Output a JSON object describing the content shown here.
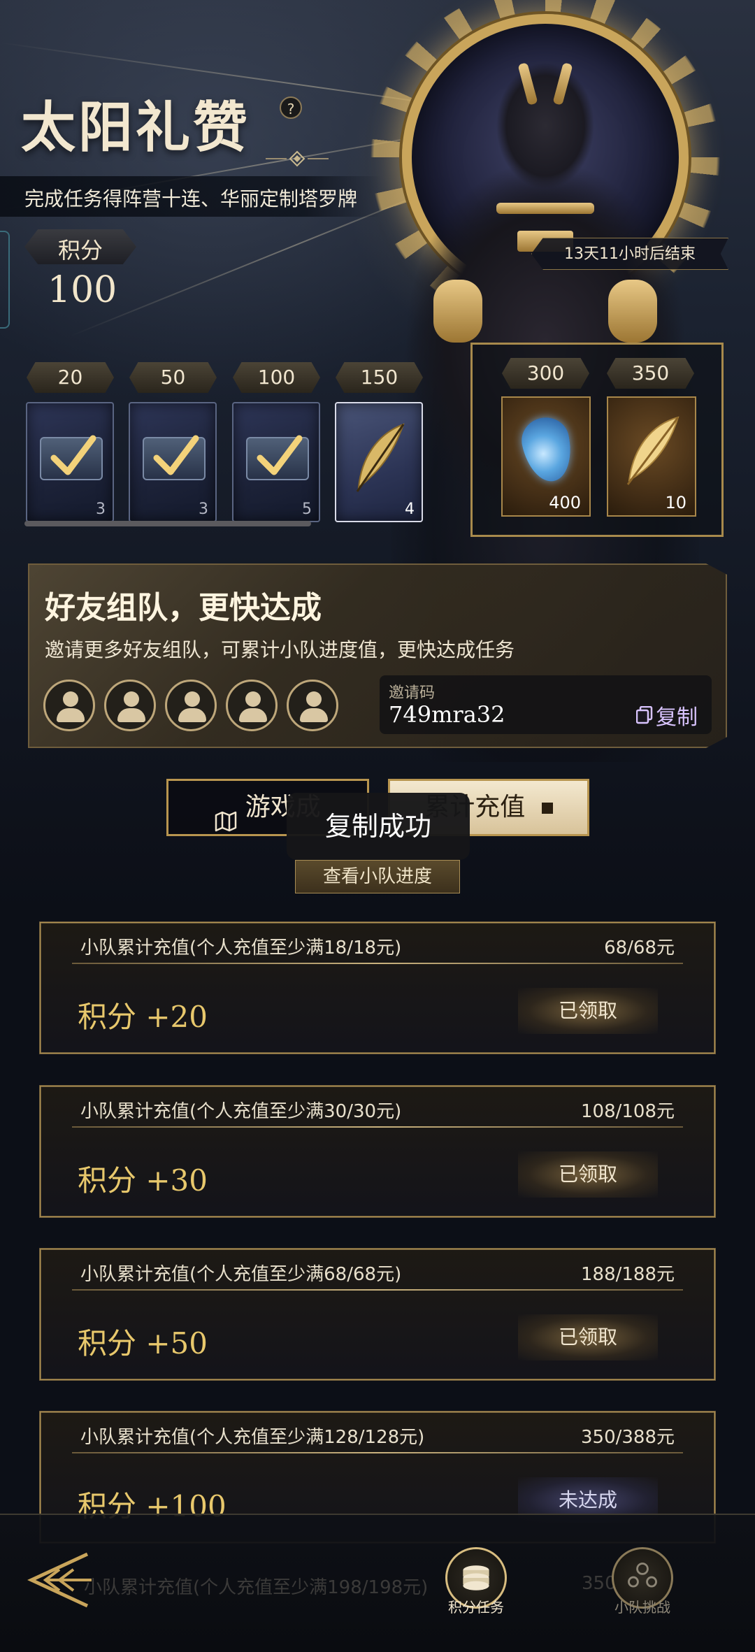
{
  "header": {
    "title": "太阳礼赞",
    "help_icon": "?",
    "subtitle": "完成任务得阵营十连、华丽定制塔罗牌",
    "points_label": "积分",
    "points_value": "100",
    "countdown": "13天11小时后结束"
  },
  "reward_track": {
    "tiers": [
      {
        "threshold": "20",
        "count": "3",
        "icon": "chest-claimed-icon"
      },
      {
        "threshold": "50",
        "count": "3",
        "icon": "chest-claimed-icon"
      },
      {
        "threshold": "100",
        "count": "5",
        "icon": "chest-claimed-icon"
      },
      {
        "threshold": "150",
        "count": "4",
        "icon": "feather-icon"
      }
    ],
    "premium": [
      {
        "threshold": "300",
        "count": "400",
        "icon": "blue-gem-icon"
      },
      {
        "threshold": "350",
        "count": "10",
        "icon": "gold-feather-icon"
      }
    ]
  },
  "team": {
    "title": "好友组队，更快达成",
    "description": "邀请更多好友组队，可累计小队进度值，更快达成任务",
    "invite_label": "邀请码",
    "invite_code": "749mra32",
    "copy_label": "复制"
  },
  "tabs": {
    "left": "游戏成",
    "right": "累计充值"
  },
  "toast": "复制成功",
  "view_progress": "查看小队进度",
  "tasks": [
    {
      "condition": "小队累计充值(个人充值至少满18/18元)",
      "progress": "68/68元",
      "reward": "积分 +20",
      "status": "已领取",
      "done": true
    },
    {
      "condition": "小队累计充值(个人充值至少满30/30元)",
      "progress": "108/108元",
      "reward": "积分 +30",
      "status": "已领取",
      "done": true
    },
    {
      "condition": "小队累计充值(个人充值至少满68/68元)",
      "progress": "188/188元",
      "reward": "积分 +50",
      "status": "已领取",
      "done": true
    },
    {
      "condition": "小队累计充值(个人充值至少满128/128元)",
      "progress": "350/388元",
      "reward": "积分 +100",
      "status": "未达成",
      "done": false
    }
  ],
  "ghost_task": {
    "condition": "小队累计充值(个人充值至少满198/198元)",
    "progress": "350"
  },
  "bottom_nav": {
    "items": [
      {
        "label": "积分任务",
        "active": true
      },
      {
        "label": "小队挑战",
        "active": false
      }
    ]
  },
  "colors": {
    "gold": "#c9a55b",
    "reward_text": "#e8c86c",
    "copy": "#d9c4ff"
  }
}
